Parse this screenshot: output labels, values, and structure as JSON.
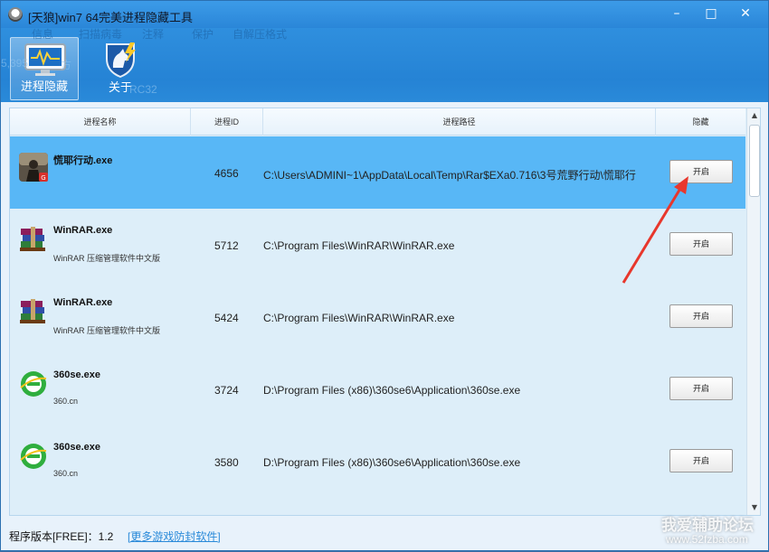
{
  "window": {
    "title": "[天狼]win7 64完美进程隐藏工具",
    "minimize": "–",
    "maximize": "□",
    "close": "✕"
  },
  "ghost_toolbar": [
    "信息",
    "扫描病毒",
    "注释",
    "保护",
    "自解压格式"
  ],
  "toolbar": {
    "tabs": [
      {
        "label": "进程隐藏",
        "icon": "monitor-pulse-icon",
        "active": true
      },
      {
        "label": "关于",
        "icon": "horse-shield-icon",
        "active": false
      }
    ],
    "faint": [
      "5,395",
      "方",
      "RC32"
    ]
  },
  "table": {
    "headers": [
      "进程名称",
      "进程ID",
      "进程路径",
      "隐藏"
    ],
    "rows": [
      {
        "name": "慌耶行动.exe",
        "desc": "",
        "pid": "4656",
        "path": "C:\\Users\\ADMINI~1\\AppData\\Local\\Temp\\Rar$EXa0.716\\3号荒野行动\\慌耶行",
        "button": "开启",
        "icon": "game-icon",
        "selected": true
      },
      {
        "name": "WinRAR.exe",
        "desc": "WinRAR 压缩管理软件中文版",
        "pid": "5712",
        "path": "C:\\Program Files\\WinRAR\\WinRAR.exe",
        "button": "开启",
        "icon": "winrar-icon",
        "selected": false
      },
      {
        "name": "WinRAR.exe",
        "desc": "WinRAR 压缩管理软件中文版",
        "pid": "5424",
        "path": "C:\\Program Files\\WinRAR\\WinRAR.exe",
        "button": "开启",
        "icon": "winrar-icon",
        "selected": false
      },
      {
        "name": "360se.exe",
        "desc": "360.cn",
        "pid": "3724",
        "path": "D:\\Program Files (x86)\\360se6\\Application\\360se.exe",
        "button": "开启",
        "icon": "360se-icon",
        "selected": false
      },
      {
        "name": "360se.exe",
        "desc": "360.cn",
        "pid": "3580",
        "path": "D:\\Program Files (x86)\\360se6\\Application\\360se.exe",
        "button": "开启",
        "icon": "360se-icon",
        "selected": false
      }
    ]
  },
  "scrollbar": {
    "up": "▲",
    "down": "▼"
  },
  "status": {
    "version": "程序版本[FREE]：1.2",
    "link": "[更多游戏防封软件]"
  },
  "watermark": {
    "site_name": "我爱辅助论坛",
    "url": "www.52fzba.com"
  },
  "colors": {
    "titlebar": "#2a86d8",
    "selected_row": "#58b7f6",
    "link": "#2a8ad9",
    "arrow": "#e8372c"
  }
}
